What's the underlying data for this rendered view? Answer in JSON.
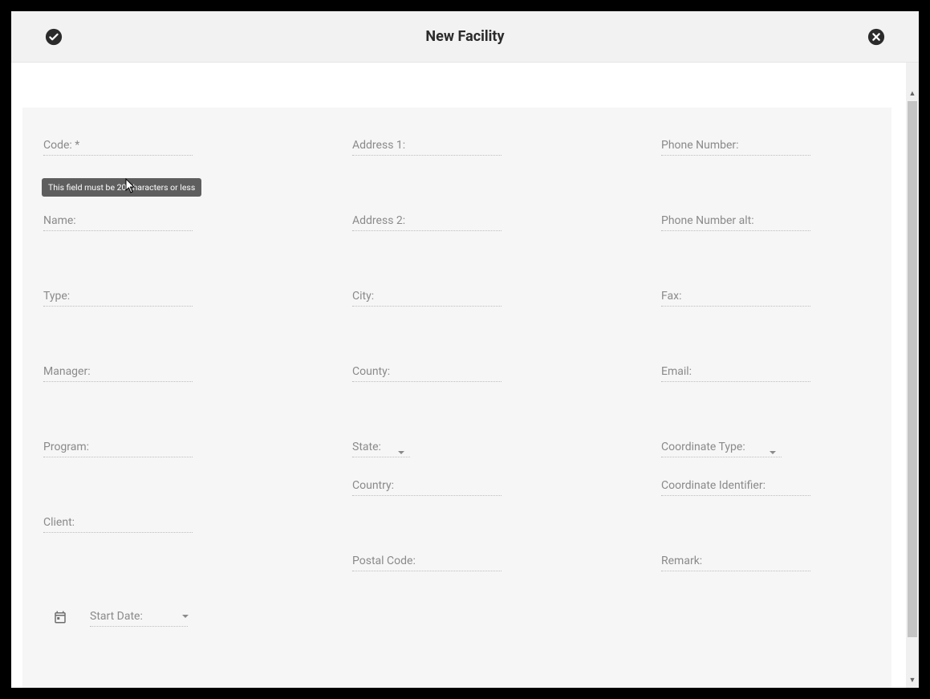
{
  "header": {
    "title": "New Facility"
  },
  "tooltip": "This field must be 20 characters or less",
  "columns": {
    "col1": [
      {
        "label": "Code: *",
        "key": "code",
        "type": "text",
        "tooltip": true
      },
      {
        "label": "Name:",
        "key": "name",
        "type": "text"
      },
      {
        "label": "Type:",
        "key": "type",
        "type": "text"
      },
      {
        "label": "Manager:",
        "key": "manager",
        "type": "text"
      },
      {
        "label": "Program:",
        "key": "program",
        "type": "text"
      },
      {
        "label": "Client:",
        "key": "client",
        "type": "text"
      }
    ],
    "col2": [
      {
        "label": "Address 1:",
        "key": "address1",
        "type": "text"
      },
      {
        "label": "Address 2:",
        "key": "address2",
        "type": "text"
      },
      {
        "label": "City:",
        "key": "city",
        "type": "text"
      },
      {
        "label": "County:",
        "key": "county",
        "type": "text"
      },
      {
        "label": "State:",
        "key": "state",
        "type": "select"
      },
      {
        "label": "Country:",
        "key": "country",
        "type": "text",
        "mt": "-23"
      },
      {
        "label": "Postal Code:",
        "key": "postal",
        "type": "text"
      }
    ],
    "col3": [
      {
        "label": "Phone Number:",
        "key": "phone",
        "type": "text"
      },
      {
        "label": "Phone Number alt:",
        "key": "phone_alt",
        "type": "text"
      },
      {
        "label": "Fax:",
        "key": "fax",
        "type": "text"
      },
      {
        "label": "Email:",
        "key": "email",
        "type": "text"
      },
      {
        "label": "Coordinate Type:",
        "key": "coord_type",
        "type": "select"
      },
      {
        "label": "Coordinate Identifier:",
        "key": "coord_id",
        "type": "text",
        "mt": "-23"
      },
      {
        "label": "Remark:",
        "key": "remark",
        "type": "text"
      }
    ]
  },
  "start_date": {
    "label": "Start Date:"
  }
}
